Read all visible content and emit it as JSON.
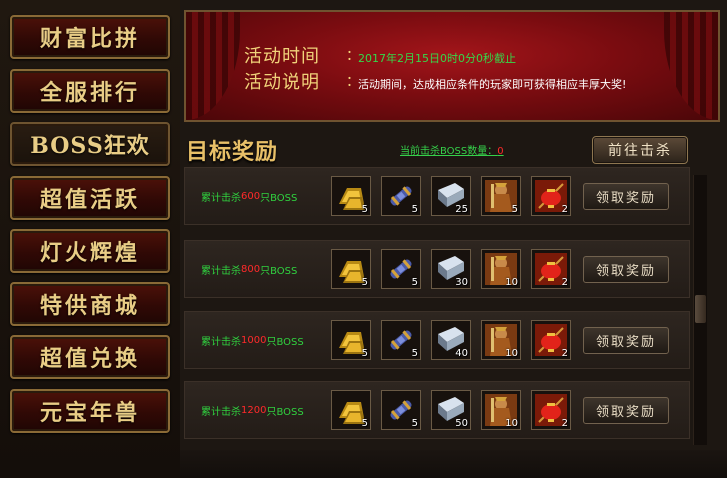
{
  "nav": {
    "items": [
      {
        "label": "财富比拼",
        "active": false
      },
      {
        "label": "全服排行",
        "active": false
      },
      {
        "label": "BOSS狂欢",
        "active": true
      },
      {
        "label": "超值活跃",
        "active": false
      },
      {
        "label": "灯火辉煌",
        "active": false
      },
      {
        "label": "特供商城",
        "active": false
      },
      {
        "label": "超值兑换",
        "active": false
      },
      {
        "label": "元宝年兽",
        "active": false
      }
    ]
  },
  "banner": {
    "time_label": "活动时间",
    "time_value": "2017年2月15日0时0分0秒截止",
    "desc_label": "活动说明",
    "desc_value": "活动期间，达成相应条件的玩家即可获得相应丰厚大奖!",
    "colon": "："
  },
  "section": {
    "title": "目标奖励",
    "kill_count_prefix": "当前击杀BOSS数量：",
    "kill_count_value": "0",
    "goto_button": "前往击杀"
  },
  "colors": {
    "green_text": "#30d23f",
    "red_number": "#ff2a2a",
    "gold_text": "#e9cd86"
  },
  "rewards": [
    {
      "prefix": "累计击杀",
      "number": "600",
      "suffix": "只BOSS",
      "items": [
        {
          "icon": "gold-ingot-icon",
          "count": "5"
        },
        {
          "icon": "scroll-icon",
          "count": "5"
        },
        {
          "icon": "steel-ingot-icon",
          "count": "25"
        },
        {
          "icon": "warrior-icon",
          "count": "5"
        },
        {
          "icon": "lantern-icon",
          "count": "2"
        }
      ],
      "claim_label": "领取奖励"
    },
    {
      "prefix": "累计击杀",
      "number": "800",
      "suffix": "只BOSS",
      "items": [
        {
          "icon": "gold-ingot-icon",
          "count": "5"
        },
        {
          "icon": "scroll-icon",
          "count": "5"
        },
        {
          "icon": "steel-ingot-icon",
          "count": "30"
        },
        {
          "icon": "warrior-icon",
          "count": "10"
        },
        {
          "icon": "lantern-icon",
          "count": "2"
        }
      ],
      "claim_label": "领取奖励"
    },
    {
      "prefix": "累计击杀",
      "number": "1000",
      "suffix": "只BOSS",
      "items": [
        {
          "icon": "gold-ingot-icon",
          "count": "5"
        },
        {
          "icon": "scroll-icon",
          "count": "5"
        },
        {
          "icon": "steel-ingot-icon",
          "count": "40"
        },
        {
          "icon": "warrior-icon",
          "count": "10"
        },
        {
          "icon": "lantern-icon",
          "count": "2"
        }
      ],
      "claim_label": "领取奖励"
    },
    {
      "prefix": "累计击杀",
      "number": "1200",
      "suffix": "只BOSS",
      "items": [
        {
          "icon": "gold-ingot-icon",
          "count": "5"
        },
        {
          "icon": "scroll-icon",
          "count": "5"
        },
        {
          "icon": "steel-ingot-icon",
          "count": "50"
        },
        {
          "icon": "warrior-icon",
          "count": "10"
        },
        {
          "icon": "lantern-icon",
          "count": "2"
        }
      ],
      "claim_label": "领取奖励"
    }
  ]
}
